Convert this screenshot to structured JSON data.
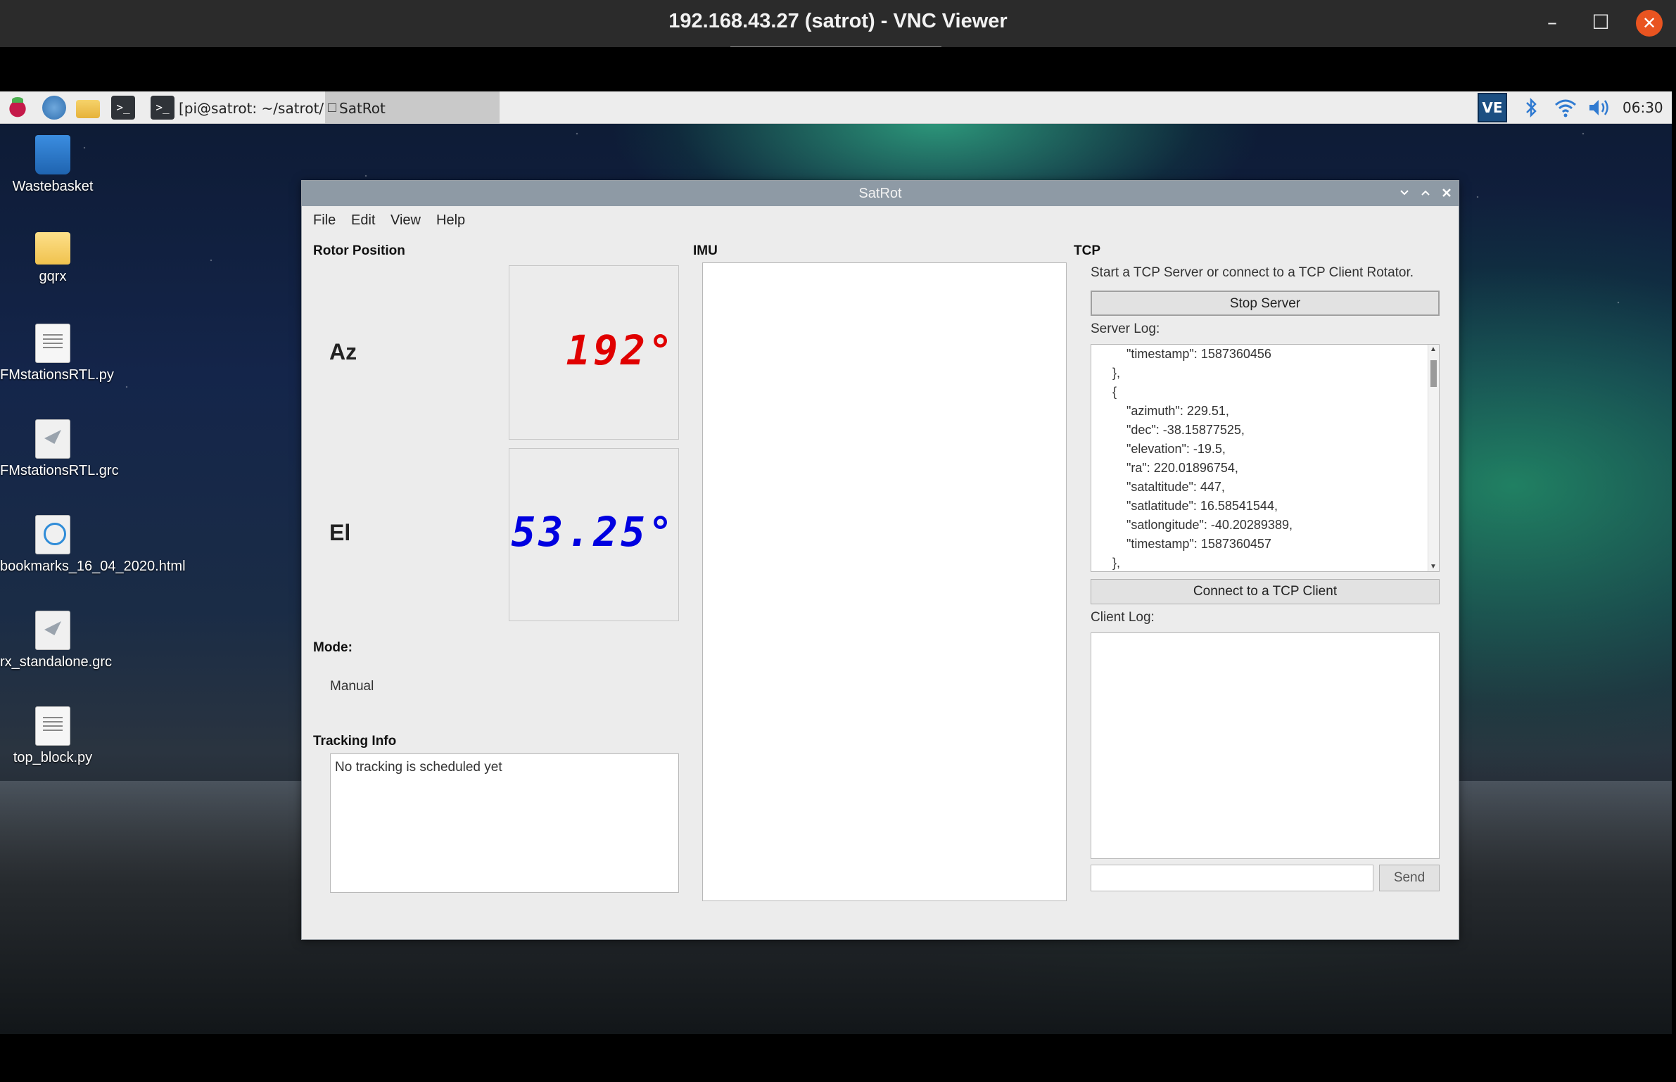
{
  "vnc": {
    "title": "192.168.43.27 (satrot) - VNC Viewer",
    "minimize_symbol": "–",
    "maximize_symbol": "☐",
    "close_symbol": "✕"
  },
  "panel": {
    "term_icon_text": ">_",
    "taskbar_terminal_label": "[pi@satrot: ~/satrot/...",
    "taskbar_satrot_label": "SatRot",
    "vnc_tray_text": "VE",
    "clock": "06:30",
    "icons": [
      "raspberry-menu-icon",
      "web-browser-icon",
      "file-manager-icon",
      "terminal-icon",
      "vnc-server-icon",
      "bluetooth-icon",
      "wifi-icon",
      "volume-icon"
    ]
  },
  "desktop_icons": [
    {
      "label": "Wastebasket",
      "icon": "trash-icon"
    },
    {
      "label": "gqrx",
      "icon": "folder-icon"
    },
    {
      "label": "FMstationsRTL.py",
      "icon": "python-file-icon"
    },
    {
      "label": "FMstationsRTL.grc",
      "icon": "grc-file-icon"
    },
    {
      "label": "bookmarks_16_04_2020.html",
      "icon": "html-file-icon"
    },
    {
      "label": "rx_standalone.grc",
      "icon": "grc-file-icon"
    },
    {
      "label": "top_block.py",
      "icon": "python-file-icon"
    }
  ],
  "satrot": {
    "window_title": "SatRot",
    "menu": [
      "File",
      "Edit",
      "View",
      "Help"
    ],
    "rotor_position": {
      "title": "Rotor Position",
      "az_label": "Az",
      "az_value": "192°",
      "az_color": "#e00000",
      "el_label": "El",
      "el_value": "53.25°",
      "el_color": "#0000e0"
    },
    "mode": {
      "label": "Mode:",
      "value": "Manual"
    },
    "tracking": {
      "title": "Tracking Info",
      "text": "No tracking is scheduled yet"
    },
    "imu": {
      "title": "IMU"
    },
    "tcp": {
      "title": "TCP",
      "description": "Start a TCP Server or connect to a TCP Client Rotator.",
      "stop_server_button": "Stop Server",
      "server_log_label": "Server Log:",
      "server_log_lines": [
        "        \"timestamp\": 1587360456",
        "    },",
        "    {",
        "        \"azimuth\": 229.51,",
        "        \"dec\": -38.15877525,",
        "        \"elevation\": -19.5,",
        "        \"ra\": 220.01896754,",
        "        \"sataltitude\": 447,",
        "        \"satlatitude\": 16.58541544,",
        "        \"satlongitude\": -40.20289389,",
        "        \"timestamp\": 1587360457",
        "    },"
      ],
      "connect_button": "Connect to a TCP Client",
      "client_log_label": "Client Log:",
      "client_input_value": "",
      "send_button": "Send"
    }
  }
}
